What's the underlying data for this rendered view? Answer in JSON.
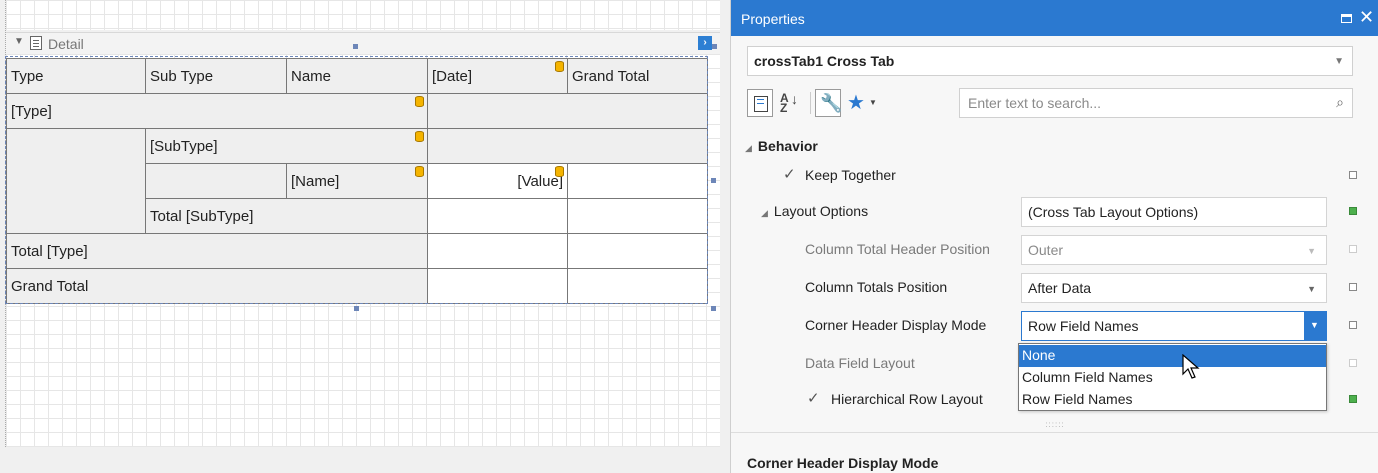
{
  "designer": {
    "band_label": "Detail",
    "crosstab": {
      "header_row": [
        "Type",
        "Sub Type",
        "Name",
        "[Date]",
        "Grand Total"
      ],
      "type_cell": "[Type]",
      "subtype_cell": "[SubType]",
      "name_cell": "[Name]",
      "value_cell": "[Value]",
      "total_subtype": "Total [SubType]",
      "total_type": "Total [Type]",
      "grand_total": "Grand Total"
    }
  },
  "properties": {
    "title": "Properties",
    "object_selector": "crossTab1  Cross Tab",
    "search_placeholder": "Enter text to search...",
    "category": "Behavior",
    "rows": {
      "keep_together": "Keep Together",
      "layout_options": "Layout Options",
      "layout_options_value": "(Cross Tab Layout Options)",
      "col_total_header_pos": "Column Total Header Position",
      "col_total_header_pos_value": "Outer",
      "col_totals_pos": "Column Totals Position",
      "col_totals_pos_value": "After Data",
      "corner_header_mode": "Corner Header Display Mode",
      "corner_header_mode_value": "Row Field Names",
      "data_field_layout": "Data Field Layout",
      "hierarchical_row_layout": "Hierarchical Row Layout"
    },
    "dropdown_options": [
      "None",
      "Column Field Names",
      "Row Field Names"
    ],
    "dropdown_highlighted": "None",
    "description_title": "Corner Header Display Mode"
  }
}
